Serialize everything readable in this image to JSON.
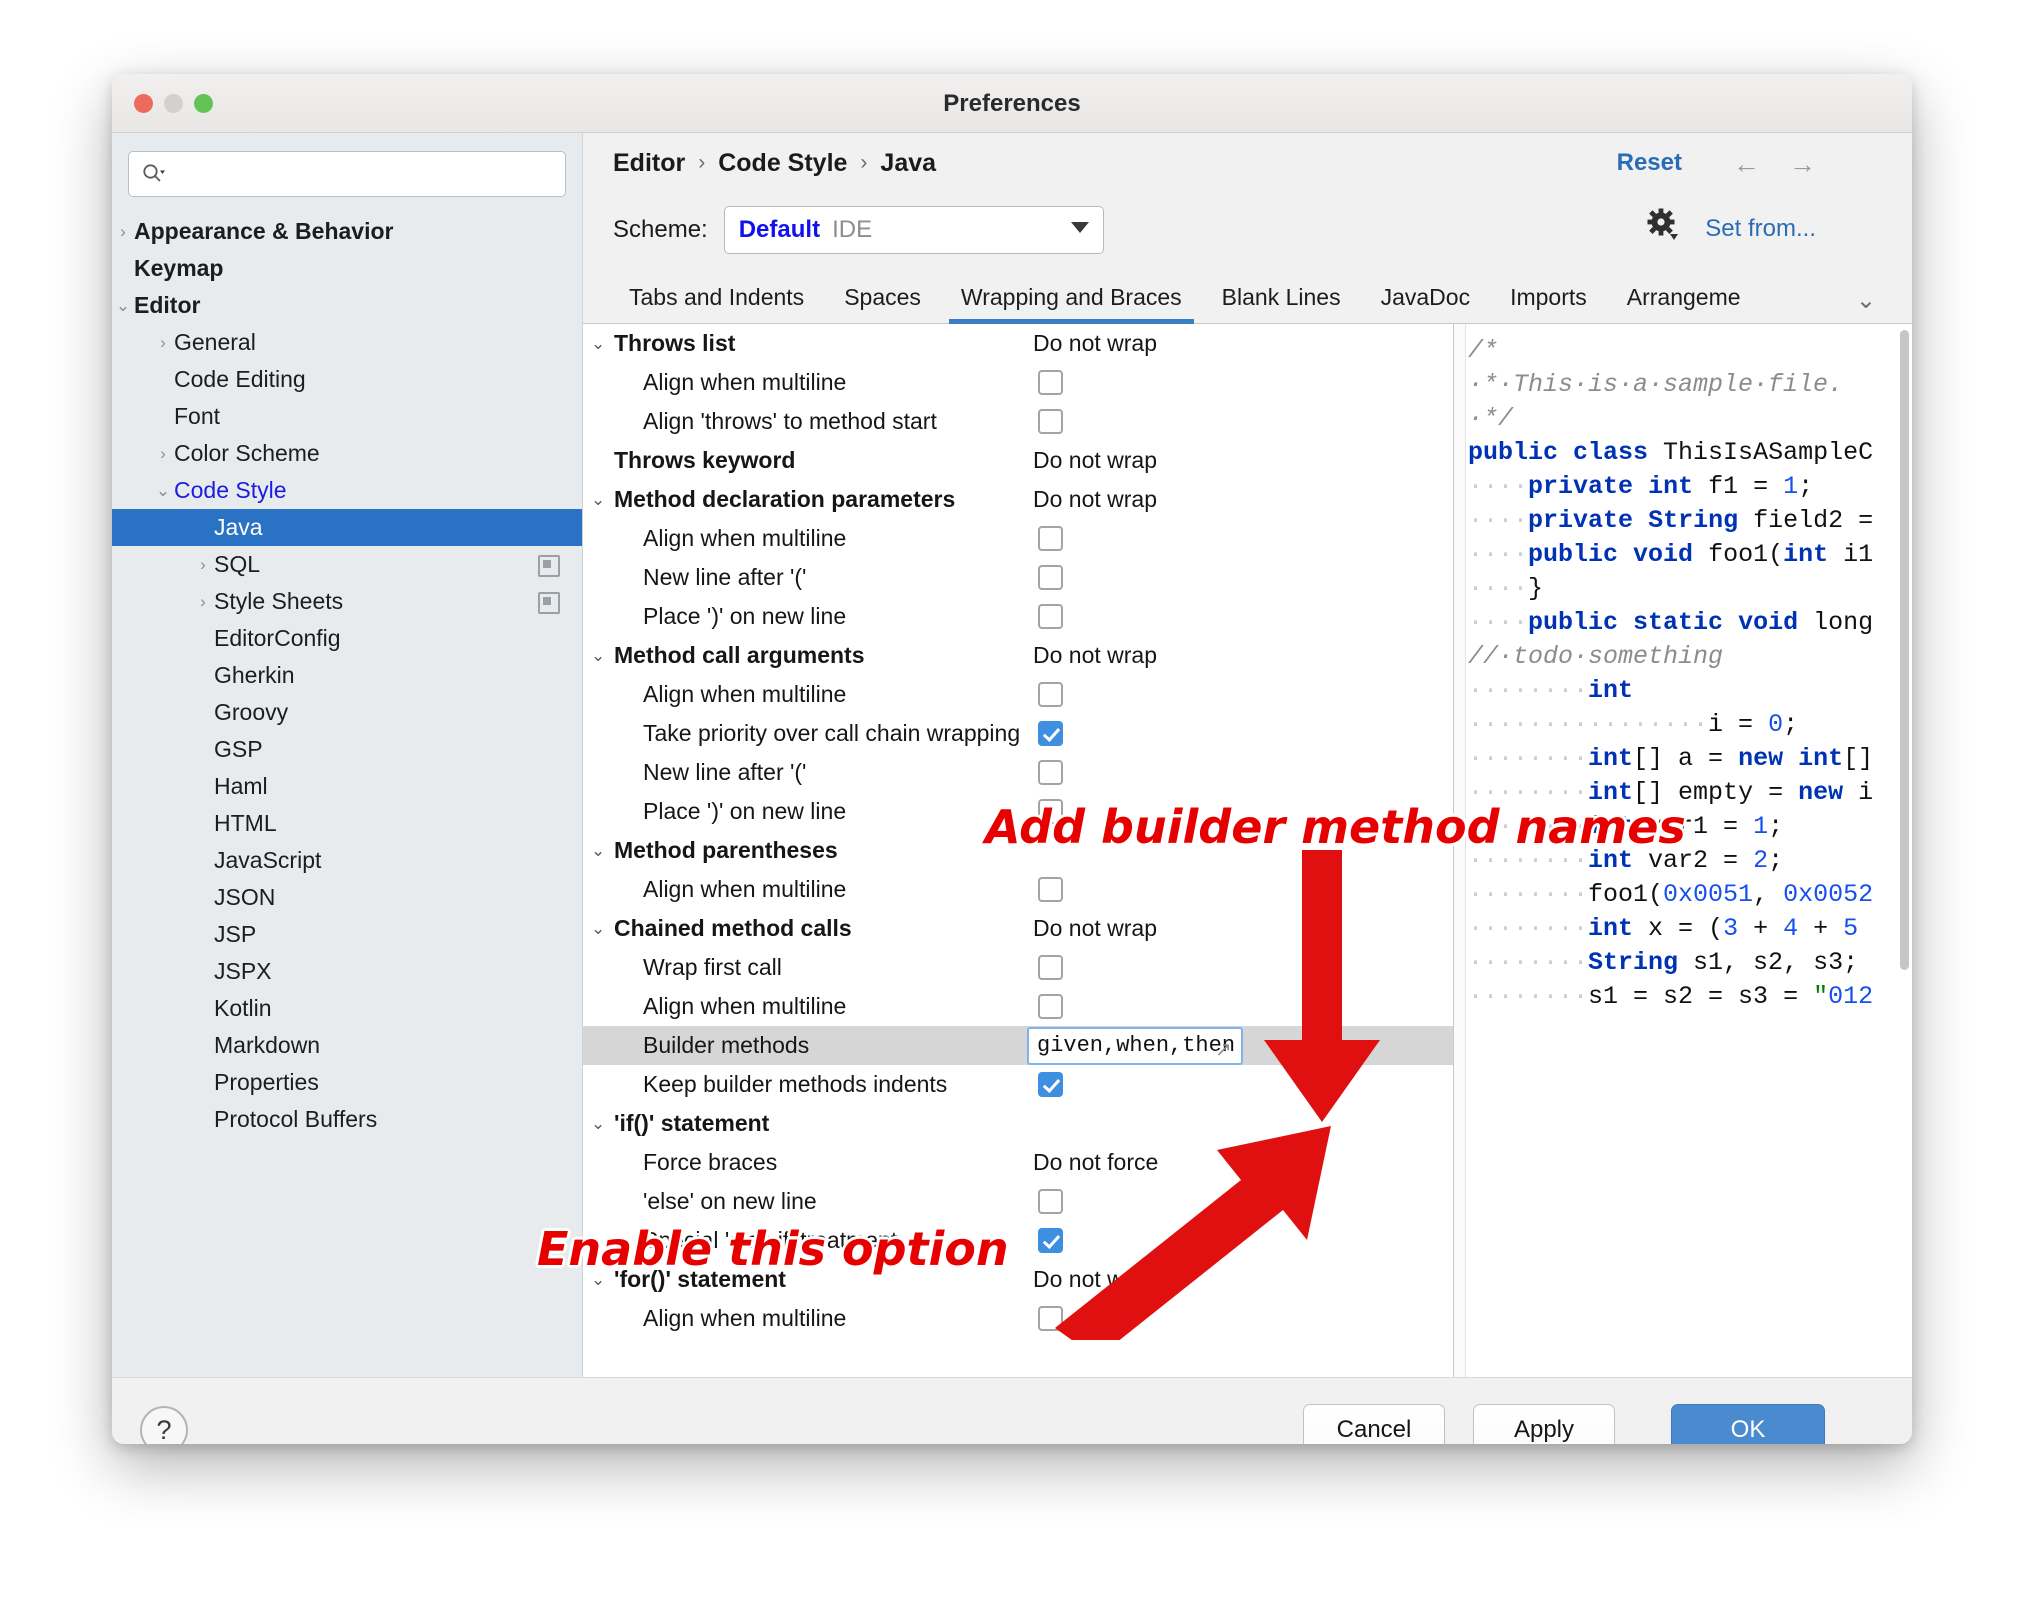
{
  "window": {
    "title": "Preferences",
    "traffic_lights": [
      "close",
      "minimize",
      "maximize"
    ]
  },
  "sidebar": {
    "search": {
      "placeholder": "",
      "value": "",
      "icon": "search-icon"
    },
    "items": [
      {
        "label": "Appearance & Behavior",
        "indent": 0,
        "arrow": "right",
        "bold": true,
        "selected": false,
        "blue": false,
        "badge": false
      },
      {
        "label": "Keymap",
        "indent": 0,
        "arrow": "",
        "bold": true,
        "selected": false,
        "blue": false,
        "badge": false
      },
      {
        "label": "Editor",
        "indent": 0,
        "arrow": "down",
        "bold": true,
        "selected": false,
        "blue": false,
        "badge": false
      },
      {
        "label": "General",
        "indent": 1,
        "arrow": "right",
        "bold": false,
        "selected": false,
        "blue": false,
        "badge": false
      },
      {
        "label": "Code Editing",
        "indent": 1,
        "arrow": "",
        "bold": false,
        "selected": false,
        "blue": false,
        "badge": false
      },
      {
        "label": "Font",
        "indent": 1,
        "arrow": "",
        "bold": false,
        "selected": false,
        "blue": false,
        "badge": false
      },
      {
        "label": "Color Scheme",
        "indent": 1,
        "arrow": "right",
        "bold": false,
        "selected": false,
        "blue": false,
        "badge": false
      },
      {
        "label": "Code Style",
        "indent": 1,
        "arrow": "down",
        "bold": false,
        "selected": false,
        "blue": true,
        "badge": false
      },
      {
        "label": "Java",
        "indent": 2,
        "arrow": "",
        "bold": false,
        "selected": true,
        "blue": false,
        "badge": false
      },
      {
        "label": "SQL",
        "indent": 2,
        "arrow": "right",
        "bold": false,
        "selected": false,
        "blue": false,
        "badge": true
      },
      {
        "label": "Style Sheets",
        "indent": 2,
        "arrow": "right",
        "bold": false,
        "selected": false,
        "blue": false,
        "badge": true
      },
      {
        "label": "EditorConfig",
        "indent": 2,
        "arrow": "",
        "bold": false,
        "selected": false,
        "blue": false,
        "badge": false
      },
      {
        "label": "Gherkin",
        "indent": 2,
        "arrow": "",
        "bold": false,
        "selected": false,
        "blue": false,
        "badge": false
      },
      {
        "label": "Groovy",
        "indent": 2,
        "arrow": "",
        "bold": false,
        "selected": false,
        "blue": false,
        "badge": false
      },
      {
        "label": "GSP",
        "indent": 2,
        "arrow": "",
        "bold": false,
        "selected": false,
        "blue": false,
        "badge": false
      },
      {
        "label": "Haml",
        "indent": 2,
        "arrow": "",
        "bold": false,
        "selected": false,
        "blue": false,
        "badge": false
      },
      {
        "label": "HTML",
        "indent": 2,
        "arrow": "",
        "bold": false,
        "selected": false,
        "blue": false,
        "badge": false
      },
      {
        "label": "JavaScript",
        "indent": 2,
        "arrow": "",
        "bold": false,
        "selected": false,
        "blue": false,
        "badge": false
      },
      {
        "label": "JSON",
        "indent": 2,
        "arrow": "",
        "bold": false,
        "selected": false,
        "blue": false,
        "badge": false
      },
      {
        "label": "JSP",
        "indent": 2,
        "arrow": "",
        "bold": false,
        "selected": false,
        "blue": false,
        "badge": false
      },
      {
        "label": "JSPX",
        "indent": 2,
        "arrow": "",
        "bold": false,
        "selected": false,
        "blue": false,
        "badge": false
      },
      {
        "label": "Kotlin",
        "indent": 2,
        "arrow": "",
        "bold": false,
        "selected": false,
        "blue": false,
        "badge": false
      },
      {
        "label": "Markdown",
        "indent": 2,
        "arrow": "",
        "bold": false,
        "selected": false,
        "blue": false,
        "badge": false
      },
      {
        "label": "Properties",
        "indent": 2,
        "arrow": "",
        "bold": false,
        "selected": false,
        "blue": false,
        "badge": false
      },
      {
        "label": "Protocol Buffers",
        "indent": 2,
        "arrow": "",
        "bold": false,
        "selected": false,
        "blue": false,
        "badge": false
      }
    ]
  },
  "header": {
    "breadcrumb": [
      "Editor",
      "Code Style",
      "Java"
    ],
    "breadcrumb_separator": "›",
    "reset_label": "Reset",
    "back_arrow": "←",
    "forward_arrow": "→",
    "scheme_label": "Scheme:",
    "scheme_name": "Default",
    "scheme_sub": "IDE",
    "scheme_gear_icon": "gear-icon",
    "set_from_label": "Set from..."
  },
  "tabs": {
    "items": [
      {
        "label": "Tabs and Indents",
        "active": false
      },
      {
        "label": "Spaces",
        "active": false
      },
      {
        "label": "Wrapping and Braces",
        "active": true
      },
      {
        "label": "Blank Lines",
        "active": false
      },
      {
        "label": "JavaDoc",
        "active": false
      },
      {
        "label": "Imports",
        "active": false
      },
      {
        "label": "Arrangeme",
        "active": false
      }
    ],
    "overflow_icon": "chevron-down-icon"
  },
  "options": [
    {
      "type": "group",
      "label": "Throws list",
      "chevron": "down",
      "value": "Do not wrap",
      "control": "text"
    },
    {
      "type": "child",
      "label": "Align when multiline",
      "chevron": "",
      "value": "",
      "control": "checkbox",
      "checked": false
    },
    {
      "type": "child",
      "label": "Align 'throws' to method start",
      "chevron": "",
      "value": "",
      "control": "checkbox",
      "checked": false
    },
    {
      "type": "group",
      "label": "Throws keyword",
      "chevron": "",
      "value": "Do not wrap",
      "control": "text"
    },
    {
      "type": "group",
      "label": "Method declaration parameters",
      "chevron": "down",
      "value": "Do not wrap",
      "control": "text"
    },
    {
      "type": "child",
      "label": "Align when multiline",
      "chevron": "",
      "value": "",
      "control": "checkbox",
      "checked": false
    },
    {
      "type": "child",
      "label": "New line after '('",
      "chevron": "",
      "value": "",
      "control": "checkbox",
      "checked": false
    },
    {
      "type": "child",
      "label": "Place ')' on new line",
      "chevron": "",
      "value": "",
      "control": "checkbox",
      "checked": false
    },
    {
      "type": "group",
      "label": "Method call arguments",
      "chevron": "down",
      "value": "Do not wrap",
      "control": "text"
    },
    {
      "type": "child",
      "label": "Align when multiline",
      "chevron": "",
      "value": "",
      "control": "checkbox",
      "checked": false
    },
    {
      "type": "child",
      "label": "Take priority over call chain wrapping",
      "chevron": "",
      "value": "",
      "control": "checkbox",
      "checked": true
    },
    {
      "type": "child",
      "label": "New line after '('",
      "chevron": "",
      "value": "",
      "control": "checkbox",
      "checked": false
    },
    {
      "type": "child",
      "label": "Place ')' on new line",
      "chevron": "",
      "value": "",
      "control": "checkbox",
      "checked": false
    },
    {
      "type": "group",
      "label": "Method parentheses",
      "chevron": "down",
      "value": "",
      "control": "none"
    },
    {
      "type": "child",
      "label": "Align when multiline",
      "chevron": "",
      "value": "",
      "control": "checkbox",
      "checked": false
    },
    {
      "type": "group",
      "label": "Chained method calls",
      "chevron": "down",
      "value": "Do not wrap",
      "control": "text"
    },
    {
      "type": "child",
      "label": "Wrap first call",
      "chevron": "",
      "value": "",
      "control": "checkbox",
      "checked": false
    },
    {
      "type": "child",
      "label": "Align when multiline",
      "chevron": "",
      "value": "",
      "control": "checkbox",
      "checked": false
    },
    {
      "type": "child",
      "label": "Builder methods",
      "chevron": "",
      "value": "given,when,then",
      "control": "input",
      "highlighted": true
    },
    {
      "type": "child",
      "label": "Keep builder methods indents",
      "chevron": "",
      "value": "",
      "control": "checkbox",
      "checked": true
    },
    {
      "type": "group",
      "label": "'if()' statement",
      "chevron": "down",
      "value": "",
      "control": "none"
    },
    {
      "type": "child",
      "label": "Force braces",
      "chevron": "",
      "value": "Do not force",
      "control": "text"
    },
    {
      "type": "child",
      "label": "'else' on new line",
      "chevron": "",
      "value": "",
      "control": "checkbox",
      "checked": false
    },
    {
      "type": "child",
      "label": "Special 'else if' treatment",
      "chevron": "",
      "value": "",
      "control": "checkbox",
      "checked": true
    },
    {
      "type": "group",
      "label": "'for()' statement",
      "chevron": "down",
      "value": "Do not wrap",
      "control": "text"
    },
    {
      "type": "child",
      "label": "Align when multiline",
      "chevron": "",
      "value": "",
      "control": "checkbox",
      "checked": false
    }
  ],
  "preview": {
    "lines": [
      "/*",
      " * This is a sample file.",
      " */",
      "",
      "public class ThisIsASampleC",
      "    private int f1 = 1;",
      "    private String field2 =",
      "",
      "    public void foo1(int i1",
      "    }",
      "",
      "    public static void long",
      "// todo something",
      "        int",
      "                i = 0;",
      "        int[] a = new int[]",
      "        int[] empty = new i",
      "        int var1 = 1;",
      "        int var2 = 2;",
      "        foo1(0x0051, 0x0052",
      "        int x = (3 + 4 + 5 ",
      "        String s1, s2, s3;",
      "        s1 = s2 = s3 = \"012"
    ]
  },
  "footer": {
    "help_icon": "question-mark-icon",
    "help_label": "?",
    "cancel_label": "Cancel",
    "apply_label": "Apply",
    "ok_label": "OK"
  },
  "annotations": [
    {
      "id": "add-builder",
      "text": "Add builder method names",
      "color": "#e60000"
    },
    {
      "id": "enable-option",
      "text": "Enable this option",
      "color": "#e60000"
    }
  ]
}
